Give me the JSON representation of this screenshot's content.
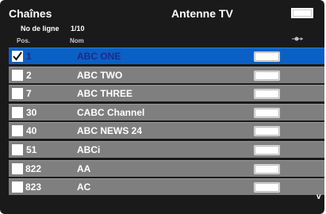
{
  "header": {
    "title": "Chaînes",
    "source": "Antenne TV",
    "line_label": "No de ligne",
    "line_value": "1/10"
  },
  "columns": {
    "pos": "Pos.",
    "nom": "Nom"
  },
  "channels": [
    {
      "pos": "1",
      "name": "ABC ONE",
      "checked": true,
      "selected": true
    },
    {
      "pos": "2",
      "name": "ABC TWO",
      "checked": false,
      "selected": false
    },
    {
      "pos": "7",
      "name": "ABC THREE",
      "checked": false,
      "selected": false
    },
    {
      "pos": "30",
      "name": "CABC Channel",
      "checked": false,
      "selected": false
    },
    {
      "pos": "40",
      "name": "ABC NEWS 24",
      "checked": false,
      "selected": false
    },
    {
      "pos": "51",
      "name": "ABCi",
      "checked": false,
      "selected": false
    },
    {
      "pos": "822",
      "name": "AA",
      "checked": false,
      "selected": false
    },
    {
      "pos": "823",
      "name": "AC",
      "checked": false,
      "selected": false
    }
  ],
  "icons": {
    "sort": "sort-eye-icon",
    "scroll": "scroll-down-icon"
  },
  "colors": {
    "background": "#1a1a1a",
    "row": "#7f7f7f",
    "selected_row": "#0a60c4",
    "selected_text": "#1f2a8a"
  }
}
